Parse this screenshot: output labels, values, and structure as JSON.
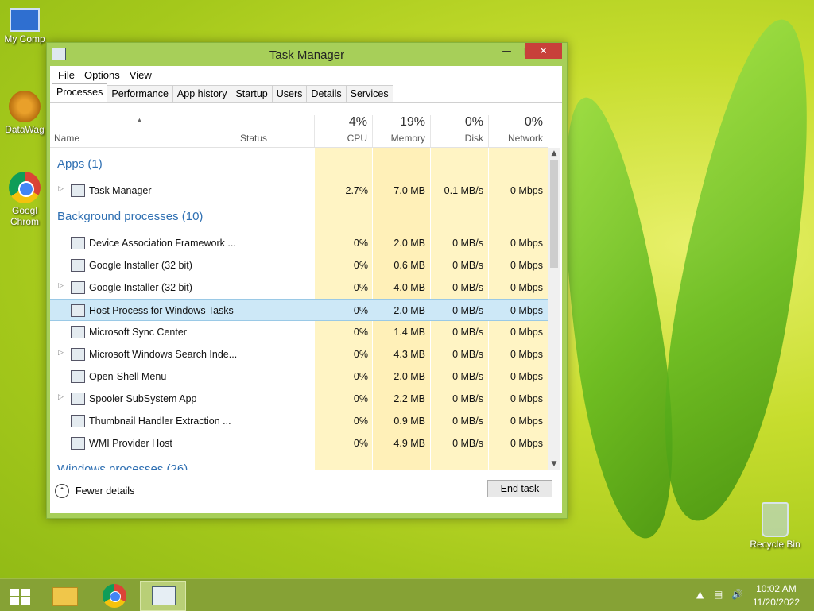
{
  "window": {
    "title": "Task Manager"
  },
  "menu": [
    "File",
    "Options",
    "View"
  ],
  "tabs": [
    "Processes",
    "Performance",
    "App history",
    "Startup",
    "Users",
    "Details",
    "Services"
  ],
  "columns": {
    "name": "Name",
    "status": "Status",
    "cpu": {
      "pct": "4%",
      "label": "CPU"
    },
    "memory": {
      "pct": "19%",
      "label": "Memory"
    },
    "disk": {
      "pct": "0%",
      "label": "Disk"
    },
    "network": {
      "pct": "0%",
      "label": "Network"
    }
  },
  "groups": {
    "apps": "Apps (1)",
    "background": "Background processes (10)",
    "windows": "Windows processes (26)"
  },
  "apps": [
    {
      "name": "Task Manager",
      "cpu": "2.7%",
      "memory": "7.0 MB",
      "disk": "0.1 MB/s",
      "network": "0 Mbps",
      "expandable": true
    }
  ],
  "background": [
    {
      "name": "Device Association Framework ...",
      "cpu": "0%",
      "memory": "2.0 MB",
      "disk": "0 MB/s",
      "network": "0 Mbps",
      "expandable": false
    },
    {
      "name": "Google Installer (32 bit)",
      "cpu": "0%",
      "memory": "0.6 MB",
      "disk": "0 MB/s",
      "network": "0 Mbps",
      "expandable": false
    },
    {
      "name": "Google Installer (32 bit)",
      "cpu": "0%",
      "memory": "4.0 MB",
      "disk": "0 MB/s",
      "network": "0 Mbps",
      "expandable": true
    },
    {
      "name": "Host Process for Windows Tasks",
      "cpu": "0%",
      "memory": "2.0 MB",
      "disk": "0 MB/s",
      "network": "0 Mbps",
      "expandable": false,
      "selected": true
    },
    {
      "name": "Microsoft Sync Center",
      "cpu": "0%",
      "memory": "1.4 MB",
      "disk": "0 MB/s",
      "network": "0 Mbps",
      "expandable": false
    },
    {
      "name": "Microsoft Windows Search Inde...",
      "cpu": "0%",
      "memory": "4.3 MB",
      "disk": "0 MB/s",
      "network": "0 Mbps",
      "expandable": true
    },
    {
      "name": "Open-Shell Menu",
      "cpu": "0%",
      "memory": "2.0 MB",
      "disk": "0 MB/s",
      "network": "0 Mbps",
      "expandable": false
    },
    {
      "name": "Spooler SubSystem App",
      "cpu": "0%",
      "memory": "2.2 MB",
      "disk": "0 MB/s",
      "network": "0 Mbps",
      "expandable": true
    },
    {
      "name": "Thumbnail Handler Extraction ...",
      "cpu": "0%",
      "memory": "0.9 MB",
      "disk": "0 MB/s",
      "network": "0 Mbps",
      "expandable": false
    },
    {
      "name": "WMI Provider Host",
      "cpu": "0%",
      "memory": "4.9 MB",
      "disk": "0 MB/s",
      "network": "0 Mbps",
      "expandable": false
    }
  ],
  "footer": {
    "fewer_details": "Fewer details",
    "end_task": "End task"
  },
  "desktop_icons": [
    "My Comp",
    "DataWag",
    "Googl Chrom"
  ],
  "recycle_bin": "Recycle Bin",
  "clock": {
    "time": "10:02 AM",
    "date": "11/20/2022"
  }
}
